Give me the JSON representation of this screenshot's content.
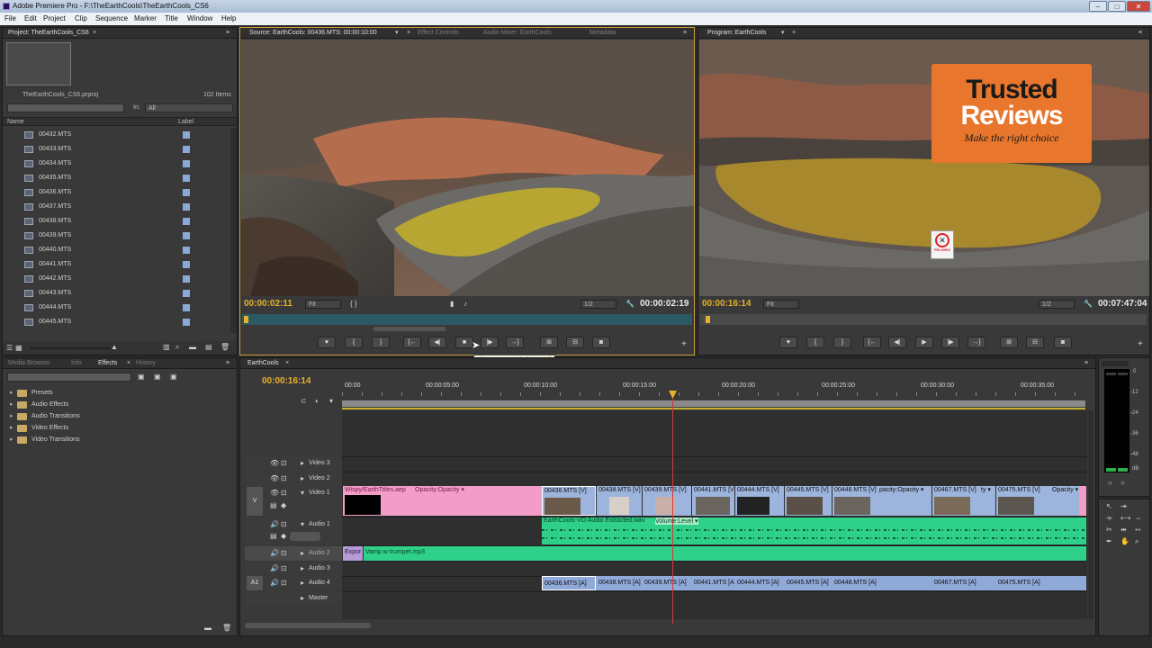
{
  "window": {
    "title": "Adobe Premiere Pro - F:\\TheEarthCools\\TheEarthCools_CS6",
    "min": "–",
    "max": "□",
    "close": "✕"
  },
  "menu": [
    "File",
    "Edit",
    "Project",
    "Clip",
    "Sequence",
    "Marker",
    "Title",
    "Window",
    "Help"
  ],
  "project": {
    "tab": "Project: TheEarthCools_CS6",
    "filename": "TheEarthCools_CS6.prproj",
    "count": "102 Items",
    "in_label": "In:",
    "in_value": "All",
    "col_name": "Name",
    "col_label": "Label",
    "items": [
      "00432.MTS",
      "00433.MTS",
      "00434.MTS",
      "00435.MTS",
      "00436.MTS",
      "00437.MTS",
      "00438.MTS",
      "00439.MTS",
      "00440.MTS",
      "00441.MTS",
      "00442.MTS",
      "00443.MTS",
      "00444.MTS",
      "00445.MTS"
    ]
  },
  "source": {
    "tabs": [
      "Source: EarthCools: 00436.MTS: 00:00:10:00",
      "Effect Controls",
      "Audio Mixer: EarthCools",
      "Metadata"
    ],
    "tc_left": "00:00:02:11",
    "fit": "Fit",
    "res": "1/2",
    "tc_right": "00:00:02:19",
    "tooltip": "Play-Stop Toggle (SPACE)"
  },
  "program": {
    "tab": "Program: EarthCools",
    "tc_left": "00:00:16:14",
    "fit": "Fit",
    "res": "1/2",
    "tc_right": "00:07:47:04"
  },
  "watermark": {
    "line1": "Trusted",
    "line2": "Reviews",
    "line3": "Make the right choice"
  },
  "sign": {
    "text": "PELIGRO"
  },
  "effects": {
    "tabs": [
      "Media Browser",
      "Info",
      "Effects",
      "History"
    ],
    "folders": [
      "Presets",
      "Audio Effects",
      "Audio Transitions",
      "Video Effects",
      "Video Transitions"
    ]
  },
  "timeline": {
    "tab": "EarthCools",
    "timecode": "00:00:16:14",
    "ruler": [
      "00:00",
      "00:00:05:00",
      "00:00:10:00",
      "00:00:15:00",
      "00:00:20:00",
      "00:00:25:00",
      "00:00:30:00",
      "00:00:35:00"
    ],
    "tracks": {
      "v3": "Video 3",
      "v2": "Video 2",
      "v1": "Video 1",
      "a1": "Audio 1",
      "a2": "Audio 2",
      "a3": "Audio 3",
      "a4": "Audio 4",
      "master": "Master",
      "v_target": "V",
      "a_target": "A1"
    },
    "v1_clips": [
      "Wispy/EarthTitles.aep",
      "Opacity:Opacity ▾",
      "00436.MTS [V]",
      "00438.MTS [V]",
      "00439.MTS [V]",
      "00441.MTS [V]",
      "00444.MTS [V]",
      "00445.MTS [V]",
      "00448.MTS [V]",
      "pacity:Opacity ▾",
      "00467.MTS [V]",
      "ty ▾",
      "00475.MTS [V]",
      "Opacity ▾"
    ],
    "a1_clip": "EarthCools-VO Audio Extracted.wav",
    "a1_key": "Volume:Level ▾",
    "a2_clips": [
      "Expor",
      "Vamp w trumpet.mp3"
    ],
    "a4_clips": [
      "00436.MTS [A]",
      "00438.MTS [A]",
      "00439.MTS [A]",
      "00441.MTS [A]",
      "00444.MTS [A]",
      "00445.MTS [A]",
      "00448.MTS [A]",
      "00467.MTS [A]",
      "00475.MTS [A]"
    ]
  },
  "meters": [
    "0",
    "-12",
    "-24",
    "-36",
    "-48",
    "dB"
  ]
}
